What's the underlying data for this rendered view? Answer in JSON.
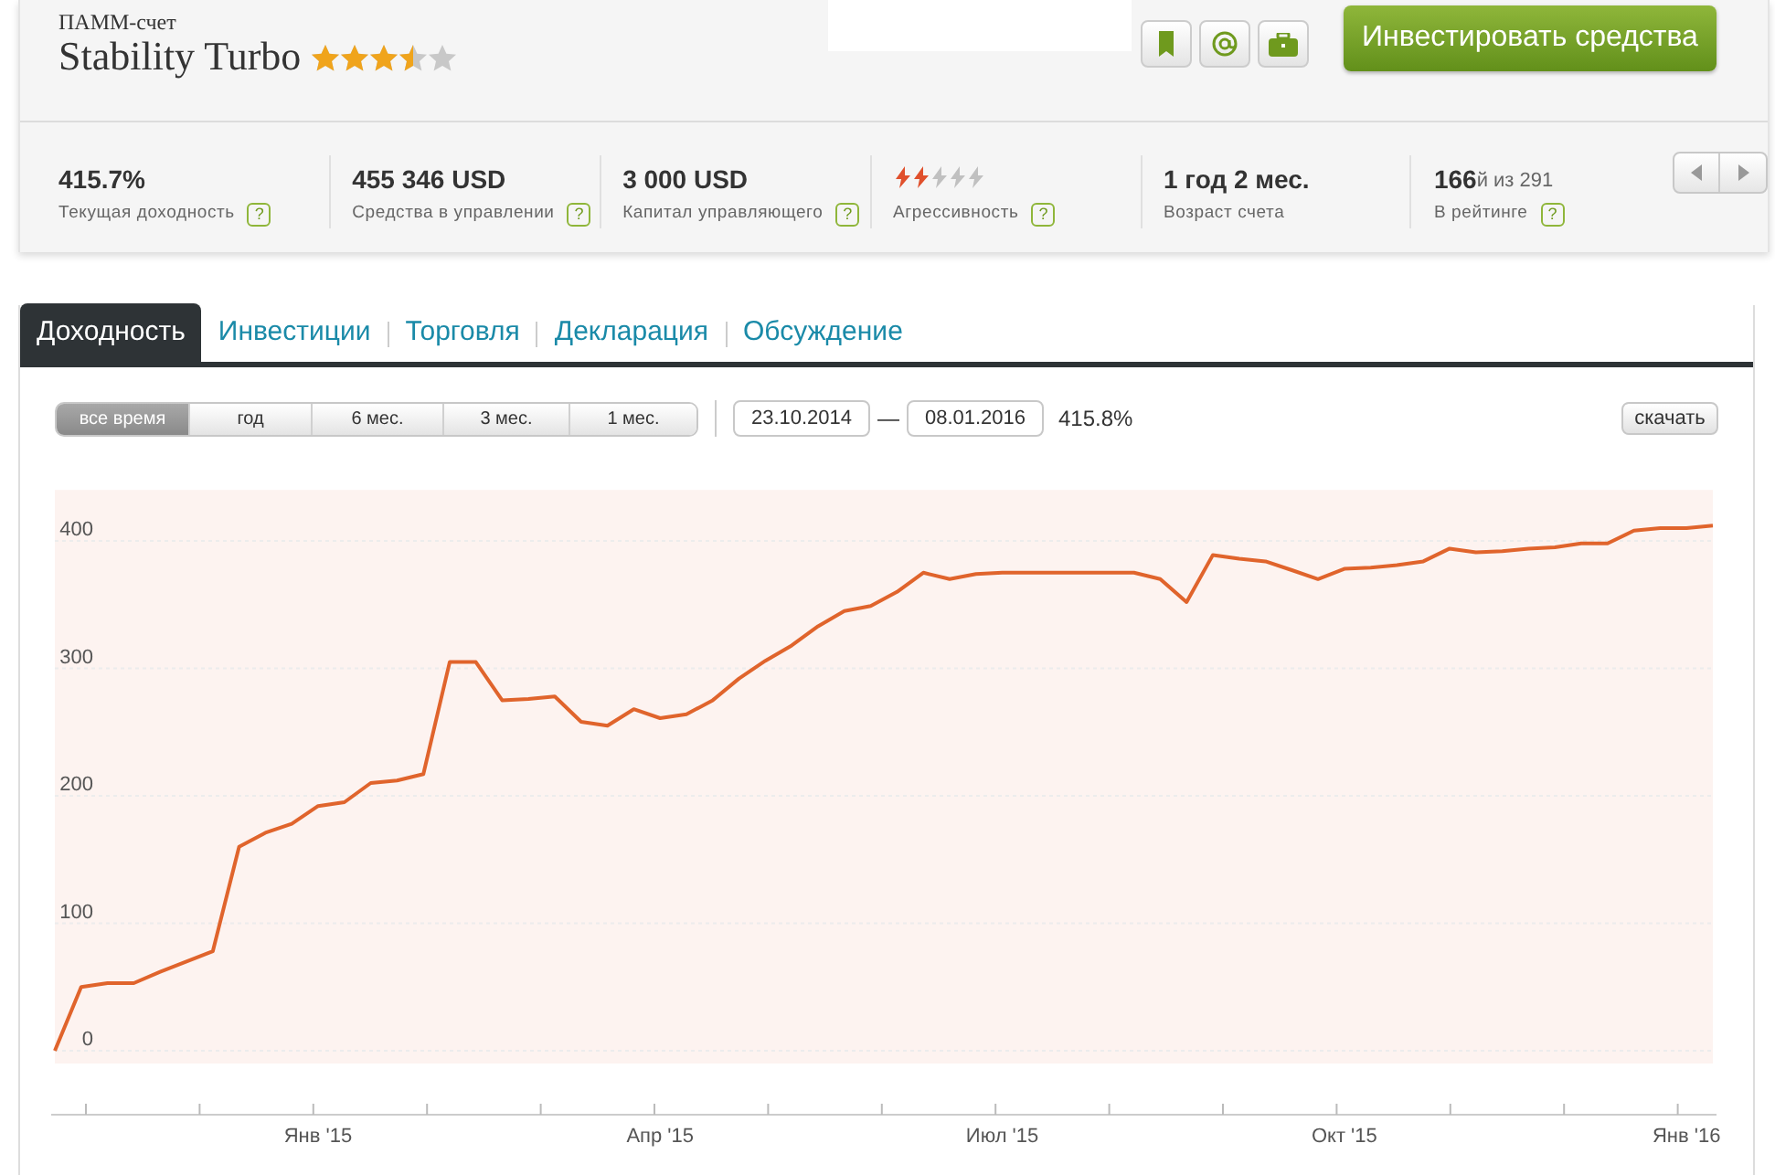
{
  "account": {
    "kind_label": "ПАММ-счет",
    "name": "Stability Turbo",
    "stars": 3.5
  },
  "actions": {
    "invest_button": "Инвестировать средства"
  },
  "stats": [
    {
      "kind": "text",
      "value": "415.7%",
      "label": "Текущая доходность",
      "help": "?"
    },
    {
      "kind": "text",
      "value": "455 346 USD",
      "label": "Средства в управлении",
      "help": "?"
    },
    {
      "kind": "text",
      "value": "3 000 USD",
      "label": "Капитал управляющего",
      "help": "?"
    },
    {
      "kind": "meter",
      "level": 0.4,
      "label": "Агрессивность",
      "help": "?"
    },
    {
      "kind": "text",
      "value": "1 год 2 мес.",
      "label": "Возраст счета"
    },
    {
      "kind": "rank",
      "value": "166",
      "suffix": "й из 291",
      "label": "В рейтинге",
      "help": "?"
    }
  ],
  "tabs": [
    {
      "label": "Доходность",
      "selected": true
    },
    {
      "label": "Инвестиции",
      "selected": false
    },
    {
      "label": "Торговля",
      "selected": false
    },
    {
      "label": "Декларация",
      "selected": false
    },
    {
      "label": "Обсуждение",
      "selected": false
    }
  ],
  "periods": [
    {
      "label": "все время",
      "selected": true
    },
    {
      "label": "год",
      "selected": false
    },
    {
      "label": "6 мес.",
      "selected": false
    },
    {
      "label": "3 мес.",
      "selected": false
    },
    {
      "label": "1 мес.",
      "selected": false
    }
  ],
  "date_from": "23.10.2014",
  "date_separator": "—",
  "date_to": "08.01.2016",
  "period_return": "415.8%",
  "download_button": "скачать",
  "chart_data": {
    "type": "line",
    "grid": true,
    "ylim": [
      -10,
      440
    ],
    "yticks": [
      0,
      100,
      200,
      300,
      400
    ],
    "categories": [
      null,
      null,
      null,
      null,
      null,
      null,
      null,
      null,
      null,
      null,
      "Янв '15",
      null,
      null,
      null,
      null,
      null,
      null,
      null,
      null,
      null,
      null,
      null,
      null,
      "Апр '15",
      null,
      null,
      null,
      null,
      null,
      null,
      null,
      null,
      null,
      null,
      null,
      null,
      "Июл '15",
      null,
      null,
      null,
      null,
      null,
      null,
      null,
      null,
      null,
      null,
      null,
      null,
      "Окт '15",
      null,
      null,
      null,
      null,
      null,
      null,
      null,
      null,
      null,
      null,
      null,
      null,
      "Янв '16",
      null
    ],
    "series": [
      {
        "color": "#e0642c",
        "values": [
          0,
          50,
          53,
          53,
          62,
          70,
          78,
          160,
          171,
          178,
          192,
          195,
          210,
          212,
          217,
          305,
          305,
          275,
          276,
          278,
          258,
          255,
          268,
          261,
          264,
          275,
          292,
          306,
          318,
          333,
          345,
          349,
          360,
          375,
          370,
          374,
          375,
          375,
          375,
          375,
          375,
          375,
          370,
          352,
          389,
          386,
          384,
          377,
          370,
          378,
          379,
          381,
          384,
          394,
          391,
          392,
          394,
          395,
          398,
          398,
          408,
          410,
          410,
          412
        ]
      }
    ]
  }
}
